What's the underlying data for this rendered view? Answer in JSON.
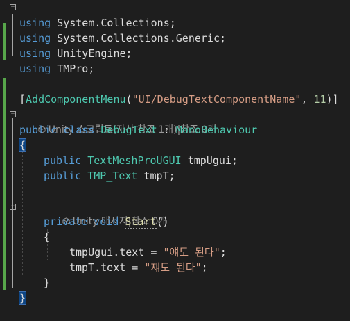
{
  "using_kw": "using",
  "usings": [
    "System.Collections;",
    "System.Collections.Generic;",
    "UnityEngine;",
    "TMPro;"
  ],
  "attribute": {
    "open": "[",
    "name": "AddComponentMenu",
    "paren_open": "(",
    "string": "\"UI/DebugTextComponentName\"",
    "comma": ", ",
    "number": "11",
    "close": ")]"
  },
  "codelens_class": "Unity 스크립트(자산 참조 1개)|참조 0개",
  "class_decl": {
    "public": "public",
    "class": "class",
    "name": "DebugText",
    "colon": " : ",
    "base": "MonoBehaviour"
  },
  "open_brace": "{",
  "close_brace": "}",
  "fields": [
    {
      "modifier": "public",
      "type": "TextMeshProUGUI",
      "name": " tmpUgui;"
    },
    {
      "modifier": "public",
      "type": "TMP_Text",
      "name": " tmpT;"
    }
  ],
  "codelens_method": "Unity 메시지|참조 0개",
  "method_decl": {
    "private": "private",
    "void": "void",
    "name": "Start",
    "parens": "()"
  },
  "statements": [
    {
      "target": "tmpUgui.text = ",
      "value": "\"얘도 된다\"",
      "end": ";"
    },
    {
      "target": "tmpT.text = ",
      "value": "\"쟤도 된다\"",
      "end": ";"
    }
  ],
  "colors": {
    "background": "#1e1e1e",
    "keyword": "#569cd6",
    "type": "#4ec9b0",
    "string": "#d69d85",
    "number": "#b5cea8",
    "change_bar": "#57a64a"
  }
}
